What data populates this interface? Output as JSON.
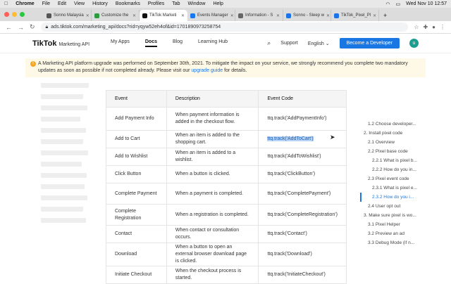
{
  "menubar": {
    "app": "Chrome",
    "items": [
      "File",
      "Edit",
      "View",
      "History",
      "Bookmarks",
      "Profiles",
      "Tab",
      "Window",
      "Help"
    ],
    "clock": "Wed Nov 10 12:57"
  },
  "tabs": [
    {
      "label": "Sonno Malaysia",
      "color": "#555"
    },
    {
      "label": "Customize the",
      "color": "#2d9b3f"
    },
    {
      "label": "TikTok Marketi",
      "color": "#111"
    },
    {
      "label": "Events Manager",
      "color": "#1877f2"
    },
    {
      "label": "Information - S",
      "color": "#666"
    },
    {
      "label": "Sonno - Sleep w",
      "color": "#1a73e8"
    },
    {
      "label": "TikTok_Pixel_Pl",
      "color": "#1a73e8"
    }
  ],
  "address": {
    "url": "ads.tiktok.com/marketing_api/docs?rid=yqyw52eh4of&id=1701890973258754"
  },
  "site": {
    "logo": "TikTok",
    "logo_sub": "Marketing API",
    "nav": [
      "My Apps",
      "Docs",
      "Blog",
      "Learning Hub"
    ],
    "support": "Support",
    "language": "English",
    "cta": "Become a Developer",
    "avatar": "u"
  },
  "banner": {
    "text": "A Marketing API platform upgrade was performed on September 30th, 2021. To mitigate the impact on your service, we strongly recommend you complete two mandatory updates as soon as possible if not completed already. Please visit our",
    "link": "upgrade guide",
    "tail": "for details."
  },
  "table": {
    "headers": [
      "Event",
      "Description",
      "Event Code"
    ],
    "rows": [
      [
        "Add Payment Info",
        "When payment information is added in the checkout flow.",
        "ttq.track('AddPaymentInfo')"
      ],
      [
        "Add to Cart",
        "When an item is added to the shopping cart.",
        "ttq.track('AddToCart')"
      ],
      [
        "Add to Wishlist",
        "When an item is added to a wishlist.",
        "ttq.track('AddToWishlist')"
      ],
      [
        "Click Button",
        "When a button is clicked.",
        "ttq.track('ClickButton')"
      ],
      [
        "Complete Payment",
        "When a payment is completed.",
        "ttq.track('CompletePayment')"
      ],
      [
        "Complete Registration",
        "When a registration is completed.",
        "ttq.track('CompleteRegistration')"
      ],
      [
        "Contact",
        "When contact or consultation occurs.",
        "ttq.track('Contact')"
      ],
      [
        "Download",
        "When a button to open an external browser download page is clicked.",
        "ttq.track('Download')"
      ],
      [
        "Initiate Checkout",
        "When the checkout process is started.",
        "ttq.track('InitiateCheckout')"
      ]
    ]
  },
  "toc": [
    "1.2 Choose developer...",
    "2. Install pixel code",
    "2.1 Overview",
    "2.2 Pixel base code",
    "2.2.1 What is pixel b...",
    "2.2.2 How do you in...",
    "2.3 Pixel event code",
    "2.3.1 What is pixel e...",
    "2.3.2 How do you i...",
    "2.4 User opt out",
    "3. Make sure pixel is wo...",
    "3.1 Pixel Helper",
    "3.2 Preview an ad",
    "3.3 Debug Mode (if n..."
  ]
}
